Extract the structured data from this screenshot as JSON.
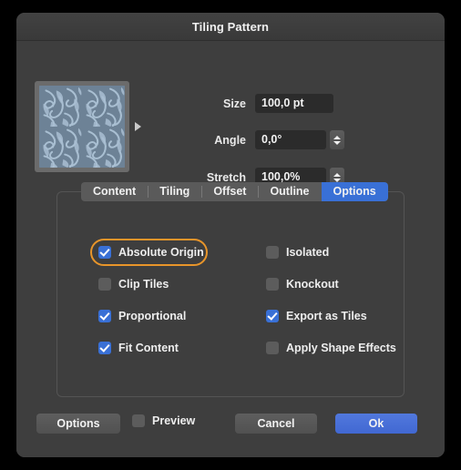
{
  "window": {
    "title": "Tiling Pattern"
  },
  "preview": {
    "swatch_name": "tiling-pattern-swatch",
    "pattern_base_color": "#6d8296",
    "pattern_motif_color": "#a9bfd2",
    "disclosure_icon": "triangle-right-icon"
  },
  "fields": [
    {
      "label": "Size",
      "value": "100,0 pt",
      "has_stepper": false
    },
    {
      "label": "Angle",
      "value": "0,0°",
      "has_stepper": true
    },
    {
      "label": "Stretch",
      "value": "100,0%",
      "has_stepper": true
    }
  ],
  "tabs": [
    {
      "label": "Content",
      "active": false
    },
    {
      "label": "Tiling",
      "active": false
    },
    {
      "label": "Offset",
      "active": false
    },
    {
      "label": "Outline",
      "active": false
    },
    {
      "label": "Options",
      "active": true
    }
  ],
  "options": {
    "left_column": [
      {
        "label": "Absolute Origin",
        "checked": true,
        "focused": true
      },
      {
        "label": "Clip Tiles",
        "checked": false,
        "focused": false
      },
      {
        "label": "Proportional",
        "checked": true,
        "focused": false
      },
      {
        "label": "Fit Content",
        "checked": true,
        "focused": false
      }
    ],
    "right_column": [
      {
        "label": "Isolated",
        "checked": false,
        "focused": false
      },
      {
        "label": "Knockout",
        "checked": false,
        "focused": false
      },
      {
        "label": "Export as Tiles",
        "checked": true,
        "focused": false
      },
      {
        "label": "Apply Shape Effects",
        "checked": false,
        "focused": false
      }
    ]
  },
  "footer": {
    "options_label": "Options",
    "preview_label": "Preview",
    "preview_checked": false,
    "cancel_label": "Cancel",
    "ok_label": "Ok"
  },
  "colors": {
    "accent_blue": "#3970d6",
    "focus_ring_orange": "#e8952a",
    "window_background": "#3e3e3e",
    "titlebar_background": "#3a3a3a",
    "field_background": "#2b2b2b"
  }
}
